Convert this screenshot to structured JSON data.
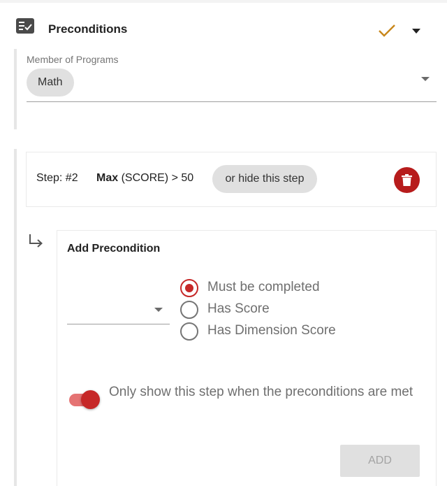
{
  "header": {
    "title": "Preconditions",
    "icon": "checklist-icon",
    "confirm_icon": "checkmark-icon",
    "expand_icon": "chevron-down-icon",
    "check_color": "#c8871b"
  },
  "programs": {
    "label": "Member of Programs",
    "chips": [
      "Math"
    ]
  },
  "step": {
    "label": "Step: #2",
    "max_keyword": "Max",
    "condition": "(SCORE) > 50",
    "hide_label": "or hide this step",
    "delete_icon": "trash-icon",
    "delete_color": "#b71c1c"
  },
  "precondition": {
    "subdirectory_icon": "subdirectory-arrow-icon",
    "title": "Add Precondition",
    "select_value": "",
    "options": [
      "Must be completed",
      "Has Score",
      "Has Dimension Score"
    ],
    "selected_option": "Must be completed",
    "toggle_label": "Only show this step when the preconditions are met",
    "toggle_on": true,
    "add_button": "ADD",
    "accent_color": "#c62828"
  }
}
